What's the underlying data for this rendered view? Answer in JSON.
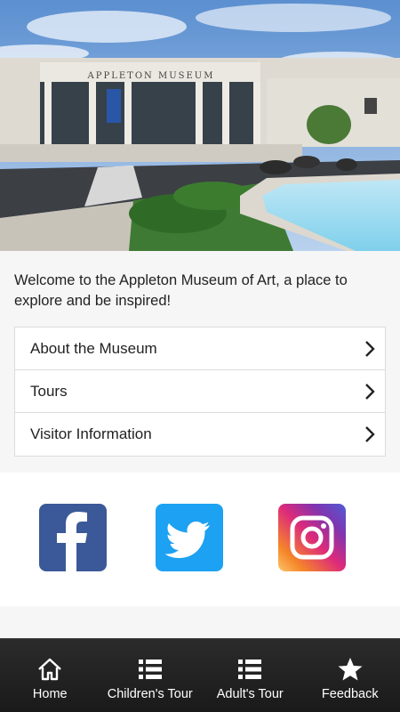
{
  "hero": {
    "building_sign": "APPLETON MUSEUM"
  },
  "welcome_text": "Welcome to the Appleton Museum of Art, a place to explore and be inspired!",
  "menu": [
    {
      "label": "About the Museum"
    },
    {
      "label": "Tours"
    },
    {
      "label": "Visitor Information"
    }
  ],
  "social": [
    {
      "icon": "facebook-icon",
      "color": "#3b5998"
    },
    {
      "icon": "twitter-icon",
      "color": "#1da1f2"
    },
    {
      "icon": "instagram-icon",
      "color": "#dd2a7b"
    }
  ],
  "tabs": [
    {
      "label": "Home",
      "icon": "home-icon"
    },
    {
      "label": "Children's Tour",
      "icon": "list-icon"
    },
    {
      "label": "Adult's Tour",
      "icon": "list-icon"
    },
    {
      "label": "Feedback",
      "icon": "star-icon"
    }
  ]
}
